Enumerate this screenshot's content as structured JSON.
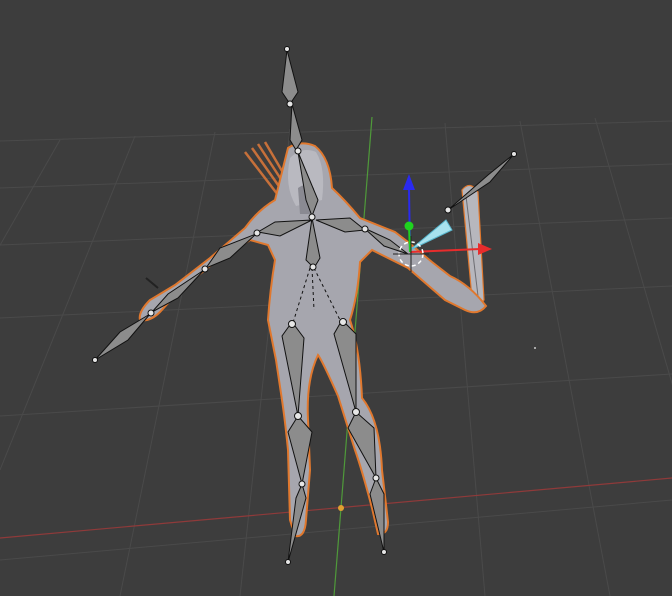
{
  "viewport": {
    "mode": "Pose Mode",
    "shading": "solid"
  },
  "colors": {
    "background": "#3d3d3d",
    "grid_line": "#4a4a4a",
    "axis_x": "#8f3a3a",
    "axis_y": "#4f9a3a",
    "gizmo_x": "#e82c2c",
    "gizmo_y": "#1fd21f",
    "gizmo_z": "#2a2af0",
    "mesh_fill": "#a6a6ae",
    "selection_outline": "#e0782e",
    "bone_fill": "#8c8c8c",
    "bone_selected": "#a8e2ee",
    "origin_point": "#e0a030"
  },
  "scene": {
    "objects": [
      "character-mesh",
      "armature",
      "quiver-with-arrows",
      "bow"
    ],
    "selected_bone": "upper-arm-left",
    "active_gizmo": "translate"
  }
}
